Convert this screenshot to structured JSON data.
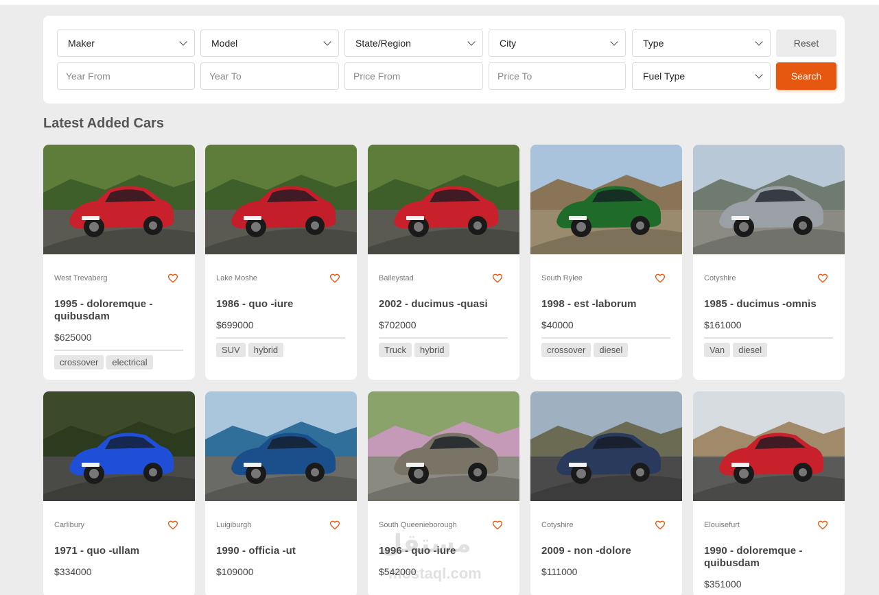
{
  "filters": {
    "maker": "Maker",
    "model": "Model",
    "state_region": "State/Region",
    "city": "City",
    "type": "Type",
    "fuel_type": "Fuel Type",
    "year_from_placeholder": "Year From",
    "year_to_placeholder": "Year To",
    "price_from_placeholder": "Price From",
    "price_to_placeholder": "Price To",
    "reset_label": "Reset",
    "search_label": "Search"
  },
  "section_title": "Latest Added Cars",
  "colors": {
    "accent": "#e6580f",
    "heart": "#e6580f"
  },
  "cars": [
    {
      "city": "West Trevaberg",
      "title": "1995 - doloremque -quibusdam",
      "price": "$625000",
      "tags": [
        "crossover",
        "electrical"
      ],
      "car_color": "#c8212b",
      "scene": "forest"
    },
    {
      "city": "Lake Moshe",
      "title": "1986 - quo -iure",
      "price": "$699000",
      "tags": [
        "SUV",
        "hybrid"
      ],
      "car_color": "#c41e2a",
      "scene": "forest"
    },
    {
      "city": "Baileystad",
      "title": "2002 - ducimus -quasi",
      "price": "$702000",
      "tags": [
        "Truck",
        "hybrid"
      ],
      "car_color": "#c8212b",
      "scene": "forest"
    },
    {
      "city": "South Rylee",
      "title": "1998 - est -laborum",
      "price": "$40000",
      "tags": [
        "crossover",
        "diesel"
      ],
      "car_color": "#1e6b2a",
      "scene": "mountain"
    },
    {
      "city": "Cotyshire",
      "title": "1985 - ducimus -omnis",
      "price": "$161000",
      "tags": [
        "Van",
        "diesel"
      ],
      "car_color": "#9aa0a6",
      "scene": "coast-road"
    },
    {
      "city": "Carlibury",
      "title": "1971 - quo -ullam",
      "price": "$334000",
      "tags": [],
      "car_color": "#1f4fd6",
      "scene": "dark-forest"
    },
    {
      "city": "Luigiburgh",
      "title": "1990 - officia -ut",
      "price": "$109000",
      "tags": [],
      "car_color": "#1b4f8c",
      "scene": "sea"
    },
    {
      "city": "South Queenieborough",
      "title": "1996 - quo -iure",
      "price": "$542000",
      "tags": [],
      "car_color": "#7a7466",
      "scene": "flowers"
    },
    {
      "city": "Cotyshire",
      "title": "2009 - non -dolore",
      "price": "$111000",
      "tags": [],
      "car_color": "#2a3a5c",
      "scene": "cliff-road"
    },
    {
      "city": "Elouisefurt",
      "title": "1990 - doloremque -quibusdam",
      "price": "$351000",
      "tags": [],
      "car_color": "#c8212b",
      "scene": "desert-road"
    }
  ],
  "watermark": {
    "arabic": "مستقل",
    "latin": "mostaql.com"
  }
}
